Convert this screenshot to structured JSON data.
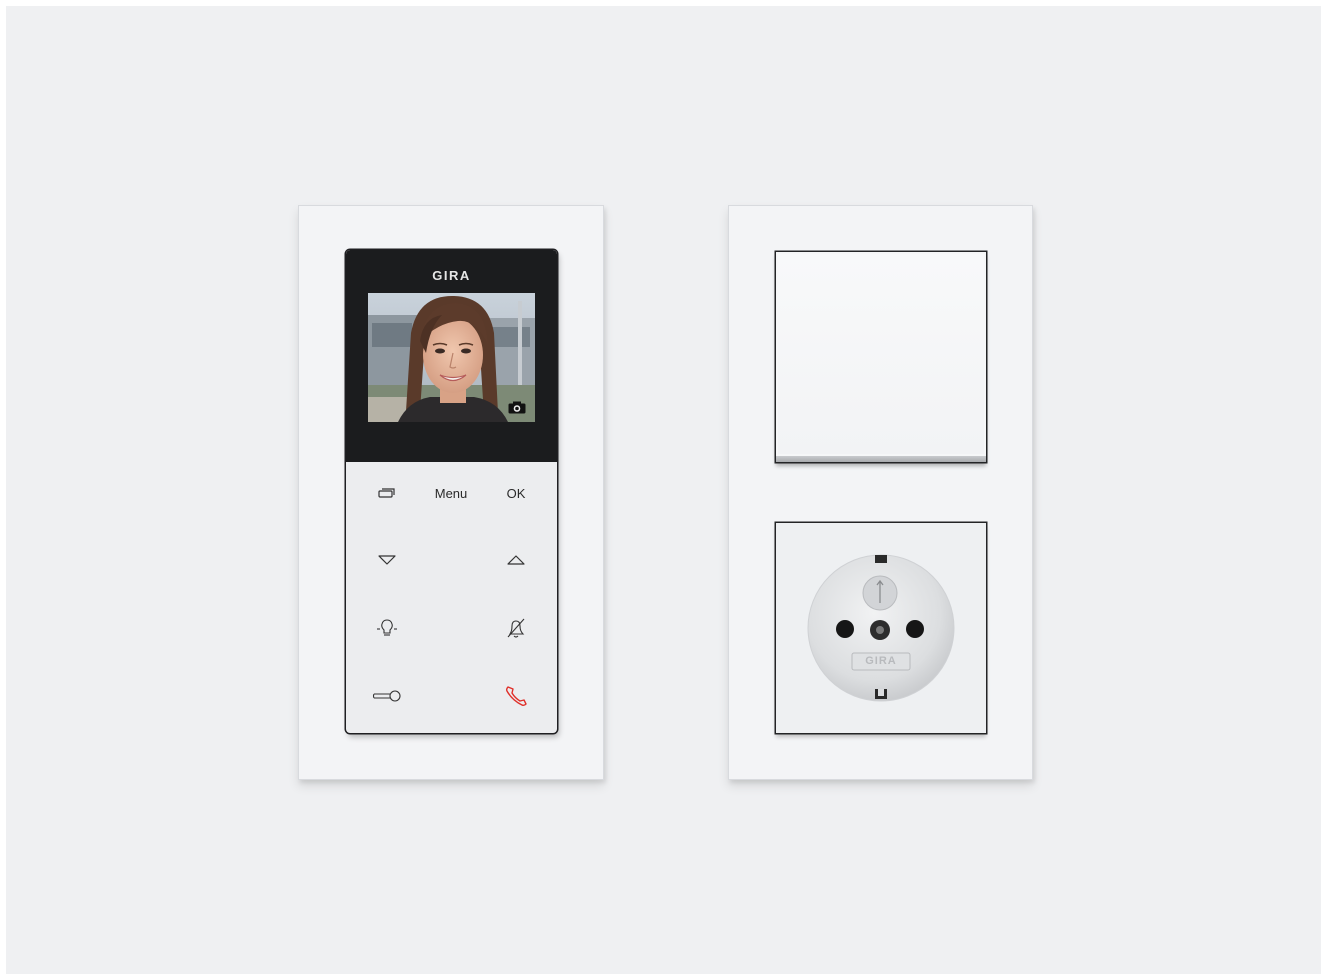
{
  "intercom": {
    "brand": "GIRA",
    "keys": {
      "menu_label": "Menu",
      "ok_label": "OK"
    },
    "icons": [
      "display-toggle-icon",
      "arrow-down-icon",
      "arrow-up-icon",
      "light-icon",
      "mute-bell-icon",
      "door-key-icon",
      "phone-hangup-icon",
      "camera-icon"
    ],
    "accent_color": "#e0302a"
  },
  "socket": {
    "brand": "GIRA"
  },
  "colors": {
    "wall": "#eff0f2",
    "frame": "#f3f4f6",
    "screen_bezel": "#1b1c1e"
  }
}
